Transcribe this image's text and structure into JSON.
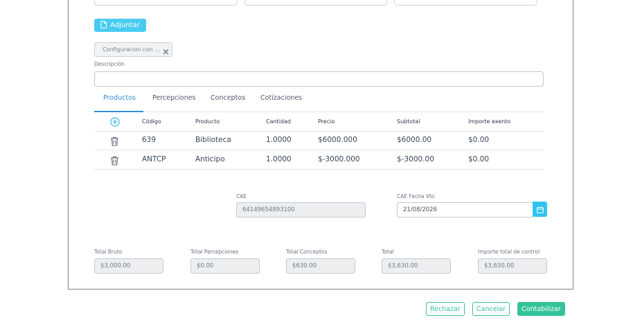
{
  "form": {
    "adjuntar_label": "Adjuntar",
    "attachment_name": "Configuracion con ...",
    "descripcion_label": "Descripción",
    "descripcion_value": ""
  },
  "tabs": [
    {
      "label": "Productos",
      "active": true
    },
    {
      "label": "Percepciones",
      "active": false
    },
    {
      "label": "Conceptos",
      "active": false
    },
    {
      "label": "Cotizaciones",
      "active": false
    }
  ],
  "table": {
    "headers": [
      "Código",
      "Producto",
      "Cantidad",
      "Precio",
      "Subtotal",
      "Importe exento"
    ],
    "rows": [
      [
        "639",
        "Biblioteca",
        "1.0000",
        "$6000.000",
        "$6000.00",
        "$0.00"
      ],
      [
        "ANTCP",
        "Anticipo",
        "1.0000",
        "$-3000.000",
        "$-3000.00",
        "$0.00"
      ]
    ]
  },
  "cae": {
    "label": "CAE",
    "value": "64149654893100"
  },
  "cae_vto": {
    "label": "CAE Fecha Vto",
    "value": "21/08/2026"
  },
  "totals": [
    {
      "label": "Total Bruto",
      "value": "$3,000.00"
    },
    {
      "label": "Total Percepciones",
      "value": "$0.00"
    },
    {
      "label": "Total Conceptos",
      "value": "$630.00"
    },
    {
      "label": "Total",
      "value": "$3,630.00"
    },
    {
      "label": "Importe total de control",
      "value": "$3,630.00"
    }
  ],
  "footer": {
    "rechazar_label": "Rechazar",
    "cancelar_label": "Cancelar",
    "contabilizar_label": "Contabilizar"
  },
  "colors": {
    "accent_blue": "#2f8fd8",
    "adjuntar_bg": "#49cbf1",
    "green": "#33c399",
    "calendar_bg": "#2fc4ef"
  },
  "icons": [
    "file-icon",
    "close-icon",
    "add-circle-icon",
    "trash-icon",
    "calendar-icon"
  ]
}
